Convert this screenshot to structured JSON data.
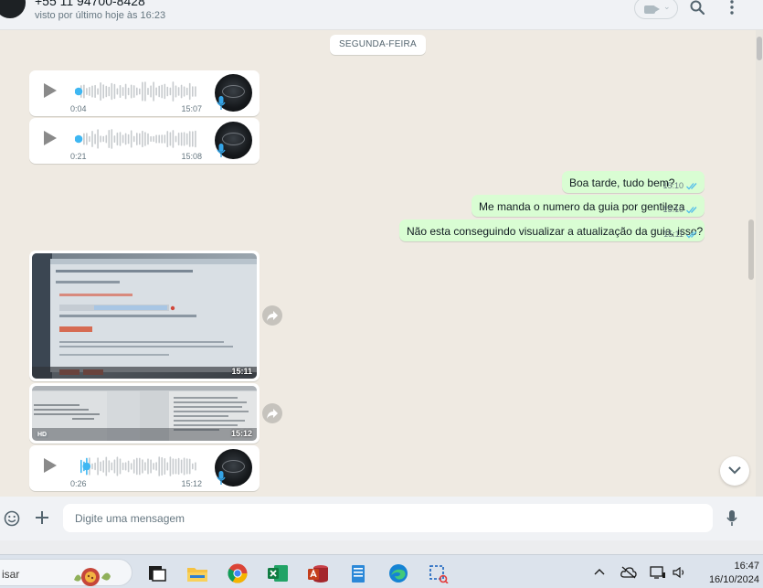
{
  "header": {
    "contact_name": "+55 11 94700-8428",
    "last_seen": "visto por último hoje às 16:23"
  },
  "chat": {
    "day_label": "SEGUNDA-FEIRA",
    "incoming_audio": [
      {
        "duration": "0:04",
        "time": "15:07",
        "progress": 0.0
      },
      {
        "duration": "0:21",
        "time": "15:08",
        "progress": 0.0
      }
    ],
    "outgoing": [
      {
        "text": "Boa tarde, tudo bem?",
        "time": "15:10",
        "status": "read"
      },
      {
        "text": "Me manda o numero da guia por gentileza",
        "time": "15:10",
        "status": "read"
      },
      {
        "text": "Não esta conseguindo visualizar a atualização da guia, isso?",
        "time": "15:11",
        "status": "read"
      }
    ],
    "incoming_media": [
      {
        "kind": "photo",
        "time": "15:11"
      },
      {
        "kind": "photo",
        "time": "15:12",
        "badge": "HD"
      }
    ],
    "incoming_audio_last": {
      "duration": "0:26",
      "time": "15:12",
      "progress": 0.07
    }
  },
  "composer": {
    "placeholder": "Digite uma mensagem"
  },
  "taskbar": {
    "search_label": "isar",
    "clock_time": "16:47",
    "clock_date": "16/10/2024"
  },
  "colors": {
    "chat_bg": "#efeae2",
    "outgoing_bubble": "#d9fdd3",
    "tick_read": "#53bdeb",
    "audio_dot": "#3fb7f2"
  }
}
